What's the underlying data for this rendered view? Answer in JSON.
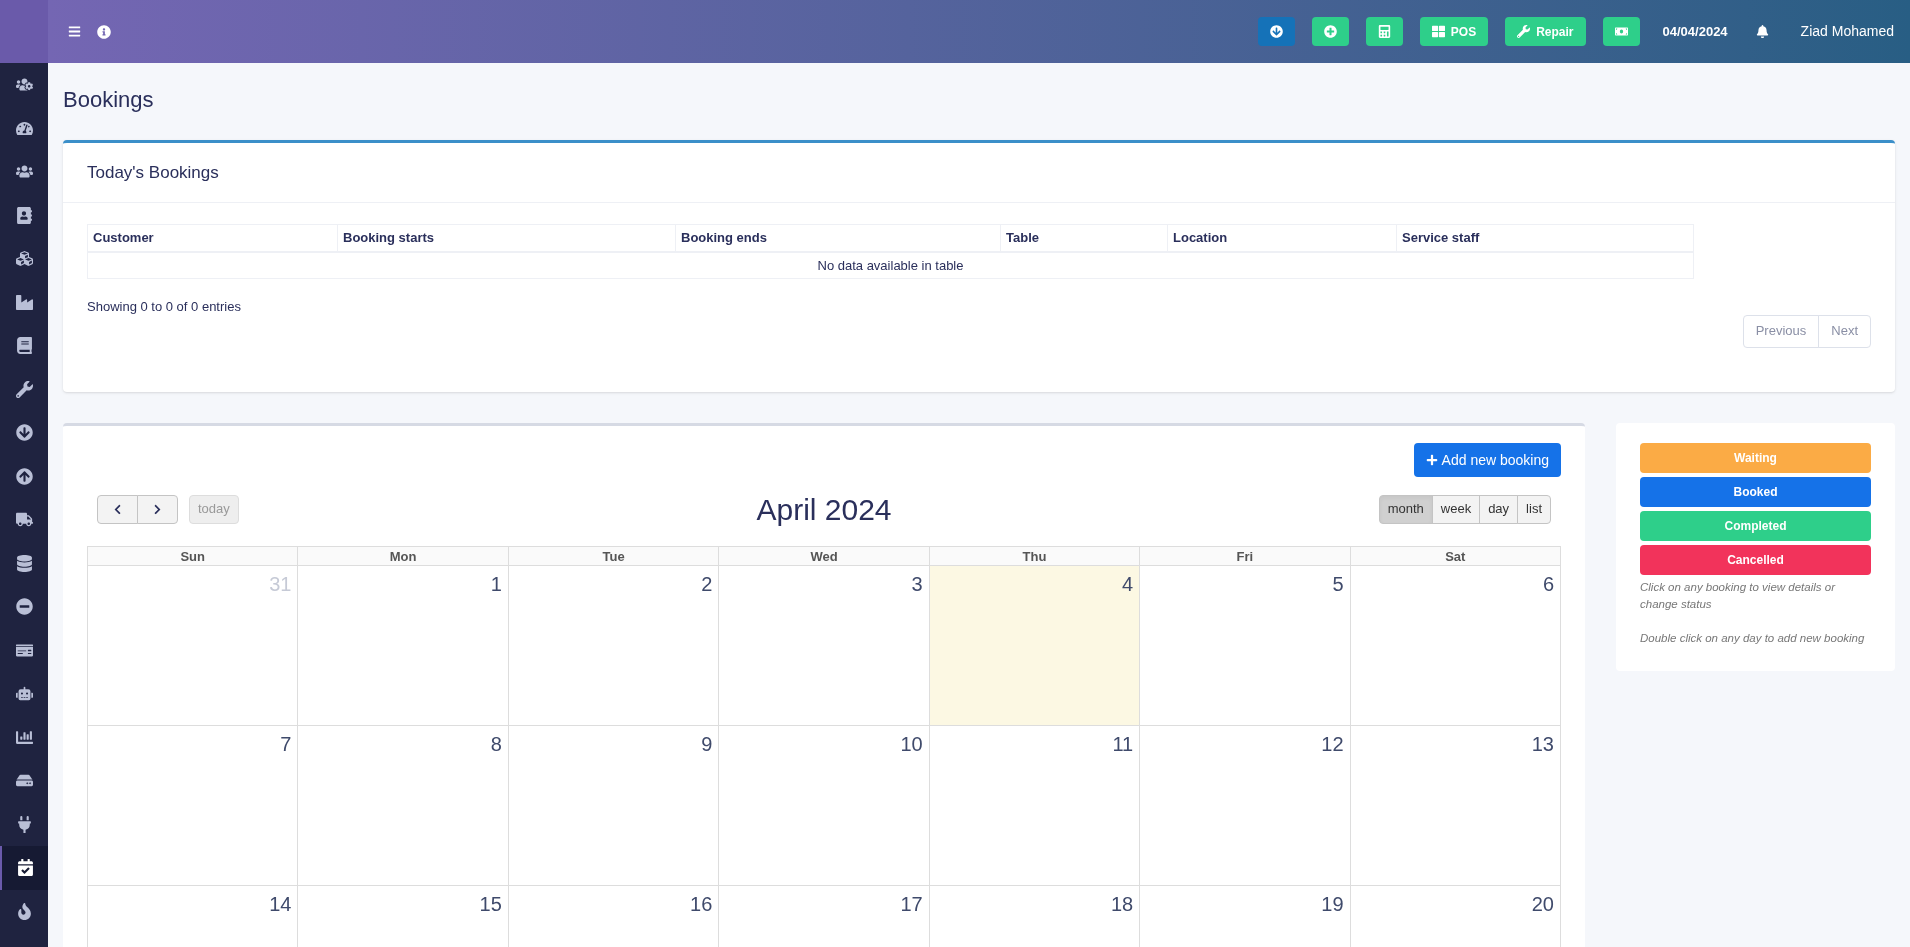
{
  "top_bar": {
    "actions": [
      {
        "kind": "download"
      },
      {
        "kind": "add"
      },
      {
        "kind": "calculator"
      },
      {
        "kind": "pos",
        "label": "POS"
      },
      {
        "kind": "repair",
        "label": "Repair"
      },
      {
        "kind": "cash"
      }
    ],
    "date": "04/04/2024",
    "user": "Ziad Mohamed"
  },
  "sidebar": {
    "items": [
      {
        "selected": false
      },
      {
        "selected": false
      },
      {
        "selected": false
      },
      {
        "selected": false
      },
      {
        "selected": false
      },
      {
        "selected": false
      },
      {
        "selected": false
      },
      {
        "selected": false
      },
      {
        "selected": false
      },
      {
        "selected": false
      },
      {
        "selected": false
      },
      {
        "selected": false
      },
      {
        "selected": false
      },
      {
        "selected": false
      },
      {
        "selected": false
      },
      {
        "selected": false
      },
      {
        "selected": false
      },
      {
        "selected": false
      },
      {
        "selected": true
      },
      {
        "selected": false
      }
    ]
  },
  "page_title": "Bookings",
  "todays_bookings": {
    "title": "Today's Bookings",
    "columns": [
      "Customer",
      "Booking starts",
      "Booking ends",
      "Table",
      "Location",
      "Service staff"
    ],
    "empty_text": "No data available in table",
    "info": "Showing 0 to 0 of 0 entries",
    "pagination": [
      "Previous",
      "Next"
    ]
  },
  "calendar": {
    "add_button": "Add new booking",
    "today_button": {
      "label": "today",
      "disabled": true
    },
    "title": "April 2024",
    "views": [
      {
        "label": "month",
        "selected": true
      },
      {
        "label": "week",
        "selected": false
      },
      {
        "label": "day",
        "selected": false
      },
      {
        "label": "list",
        "selected": false
      }
    ],
    "weekdays": [
      "Sun",
      "Mon",
      "Tue",
      "Wed",
      "Thu",
      "Fri",
      "Sat"
    ],
    "weeks": [
      [
        {
          "day": "31",
          "other_month": true,
          "today": false
        },
        {
          "day": "1",
          "other_month": false,
          "today": false
        },
        {
          "day": "2",
          "other_month": false,
          "today": false
        },
        {
          "day": "3",
          "other_month": false,
          "today": false
        },
        {
          "day": "4",
          "other_month": false,
          "today": true
        },
        {
          "day": "5",
          "other_month": false,
          "today": false
        },
        {
          "day": "6",
          "other_month": false,
          "today": false
        }
      ],
      [
        {
          "day": "7",
          "other_month": false,
          "today": false
        },
        {
          "day": "8",
          "other_month": false,
          "today": false
        },
        {
          "day": "9",
          "other_month": false,
          "today": false
        },
        {
          "day": "10",
          "other_month": false,
          "today": false
        },
        {
          "day": "11",
          "other_month": false,
          "today": false
        },
        {
          "day": "12",
          "other_month": false,
          "today": false
        },
        {
          "day": "13",
          "other_month": false,
          "today": false
        }
      ],
      [
        {
          "day": "14",
          "other_month": false,
          "today": false
        },
        {
          "day": "15",
          "other_month": false,
          "today": false
        },
        {
          "day": "16",
          "other_month": false,
          "today": false
        },
        {
          "day": "17",
          "other_month": false,
          "today": false
        },
        {
          "day": "18",
          "other_month": false,
          "today": false
        },
        {
          "day": "19",
          "other_month": false,
          "today": false
        },
        {
          "day": "20",
          "other_month": false,
          "today": false
        }
      ]
    ]
  },
  "legend": {
    "statuses": [
      {
        "label": "Waiting",
        "color": "#fbab45"
      },
      {
        "label": "Booked",
        "color": "#1572e8"
      },
      {
        "label": "Completed",
        "color": "#2ecf8a"
      },
      {
        "label": "Cancelled",
        "color": "#f2335b"
      }
    ],
    "notes": [
      "Click on any booking to view details or change status",
      "Double click on any day to add new booking"
    ]
  }
}
